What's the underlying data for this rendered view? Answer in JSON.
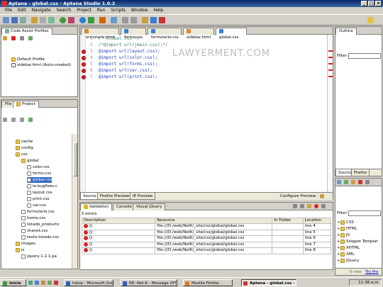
{
  "window": {
    "title": "Aptana - global.css - Aptana Studio 1.0.2"
  },
  "menu": [
    "File",
    "Edit",
    "Navigate",
    "Search",
    "Project",
    "Run",
    "Scripts",
    "Window",
    "Help"
  ],
  "code_assist": {
    "tab": "Code Assist Profiles",
    "items": [
      "Default Profile",
      "sidebar.html (Auto-created)"
    ]
  },
  "project": {
    "tabs": [
      "File",
      "Project"
    ],
    "tree": [
      {
        "label": "cache",
        "type": "folder",
        "level": 1
      },
      {
        "label": "config",
        "type": "folder",
        "level": 1
      },
      {
        "label": "css",
        "type": "folder",
        "level": 1
      },
      {
        "label": "global",
        "type": "folder",
        "level": 2
      },
      {
        "label": "color.css",
        "type": "file",
        "level": 3
      },
      {
        "label": "forms.css",
        "type": "file",
        "level": 3
      },
      {
        "label": "global.css",
        "type": "file",
        "level": 3,
        "selected": true
      },
      {
        "label": "ie-bugfixes.c",
        "type": "file",
        "level": 3
      },
      {
        "label": "layout.css",
        "type": "file",
        "level": 3
      },
      {
        "label": "print.css",
        "type": "file",
        "level": 3
      },
      {
        "label": "var.css",
        "type": "file",
        "level": 3
      },
      {
        "label": "formulario.css",
        "type": "file",
        "level": 2
      },
      {
        "label": "home.css",
        "type": "file",
        "level": 2
      },
      {
        "label": "listado_producto",
        "type": "file",
        "level": 2
      },
      {
        "label": "shared.css",
        "type": "file",
        "level": 2
      },
      {
        "label": "texto-listado.css",
        "type": "file",
        "level": 2
      },
      {
        "label": "images",
        "type": "folder",
        "level": 1
      },
      {
        "label": "js",
        "type": "folder",
        "level": 1
      },
      {
        "label": "jquery-1.2.1.pa",
        "type": "file",
        "level": 2
      }
    ]
  },
  "editor": {
    "tabs": [
      "formulario.html",
      "forms.css",
      "formulario.css",
      "sidebar.html",
      "global.css"
    ],
    "active_tab": "global.css",
    "lines": [
      {
        "num": "1",
        "text": "/* Global CSS */",
        "style": "comment",
        "error": false
      },
      {
        "num": "2",
        "text": "/*@import url(jmain.css);*/",
        "style": "comment",
        "error": false
      },
      {
        "num": "3",
        "text": "@import url(layout.css);",
        "style": "code",
        "error": true
      },
      {
        "num": "4",
        "text": "@import url(color.css);",
        "style": "code",
        "error": true
      },
      {
        "num": "5",
        "text": "@import url(forms.css);",
        "style": "code",
        "error": true
      },
      {
        "num": "6",
        "text": "@import url(var.css);",
        "style": "code",
        "error": true
      },
      {
        "num": "7",
        "text": "@import url(print.css);",
        "style": "code",
        "error": true
      }
    ],
    "bottom_tabs": [
      "Source",
      "Firefox Preview",
      "IE Preview"
    ],
    "configure_preview": "Configure Preview:"
  },
  "problems": {
    "tabs": [
      "Validation",
      "Console",
      "Visual jQuery"
    ],
    "count": "5 errors",
    "headers": [
      "Description",
      "Resource",
      "In Folder",
      "Location"
    ],
    "rows": [
      {
        "desc": "D",
        "resource": "file:///D:/web/NetK/_site/css/global/global.css",
        "folder": "",
        "location": "line 4"
      },
      {
        "desc": "D",
        "resource": "file:///D:/web/NetK/_site/css/global/global.css",
        "folder": "",
        "location": "line 5"
      },
      {
        "desc": "D",
        "resource": "file:///D:/web/NetK/_site/css/global/global.css",
        "folder": "",
        "location": "line 6"
      },
      {
        "desc": "D",
        "resource": "file:///D:/web/NetK/_site/css/global/global.css",
        "folder": "",
        "location": "line 7"
      },
      {
        "desc": "D",
        "resource": "file:///D:/web/NetK/_site/css/global/global.css",
        "folder": "",
        "location": "line 8"
      }
    ]
  },
  "outline": {
    "tab": "Outline",
    "filter_label": "Filter:",
    "bottom_tabs": [
      "Source",
      "Firefox"
    ]
  },
  "snippets": {
    "filter_label": "Filter:",
    "items": [
      "CSS",
      "HTML",
      "JS",
      "Snippet Templat",
      "XHTML",
      "XML",
      "jQuery"
    ],
    "news": "0 new",
    "try_pro": "Try Pro"
  },
  "watermark": "LAWYERMENT.COM",
  "taskbar": {
    "start": "Inicio",
    "tasks": [
      "Inbox - Microsoft Outlook",
      "RE: Net-K - Message (HT...",
      "Mozilla Firefox",
      "Aptana - global.css - ..."
    ],
    "active_task": 3,
    "clock": "11:38 a.m."
  }
}
